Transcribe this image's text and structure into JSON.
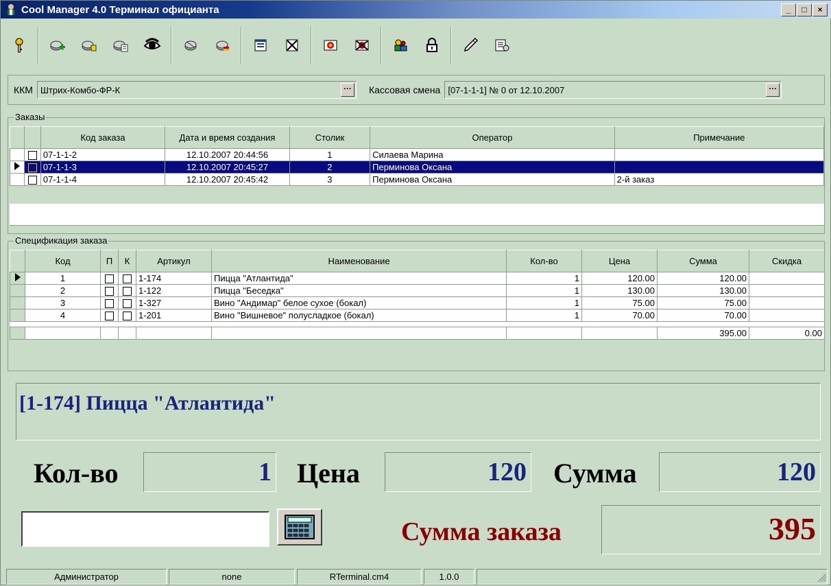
{
  "window": {
    "title": "Cool Manager 4.0  Терминал официанта",
    "minimize": "_",
    "maximize": "□",
    "close": "×"
  },
  "toolbar": {
    "buttons": [
      {
        "icon": "help-key-icon"
      },
      {
        "icon": "new-order-icon"
      },
      {
        "icon": "edit-order-icon"
      },
      {
        "icon": "copy-order-icon"
      },
      {
        "icon": "view-eye-icon"
      },
      {
        "icon": "print-icon"
      },
      {
        "icon": "print-colored-icon"
      },
      {
        "icon": "document-icon"
      },
      {
        "icon": "document-cancel-icon"
      },
      {
        "icon": "payment-icon"
      },
      {
        "icon": "payment-cancel-icon"
      },
      {
        "icon": "users-icon"
      },
      {
        "icon": "lock-icon"
      },
      {
        "icon": "pen-icon"
      },
      {
        "icon": "properties-icon"
      }
    ]
  },
  "kkm": {
    "label": "ККМ",
    "value": "Штрих-Комбо-ФР-К",
    "button": "···",
    "shift_label": "Кассовая смена",
    "shift_value": "[07-1-1-1] № 0 от 12.10.2007",
    "shift_button": "···"
  },
  "orders": {
    "legend": "Заказы",
    "columns": [
      "Код заказа",
      "Дата и время создания",
      "Столик",
      "Оператор",
      "Примечание"
    ],
    "rows": [
      {
        "code": "07-1-1-2",
        "date": "12.10.2007 20:44:56",
        "table": "1",
        "operator": "Силаева Марина",
        "note": ""
      },
      {
        "code": "07-1-1-3",
        "date": "12.10.2007 20:45:27",
        "table": "2",
        "operator": "Перминова Оксана",
        "note": ""
      },
      {
        "code": "07-1-1-4",
        "date": "12.10.2007 20:45:42",
        "table": "3",
        "operator": "Перминова Оксана",
        "note": "2-й заказ"
      }
    ]
  },
  "spec": {
    "legend": "Спецификация заказа",
    "columns": [
      "Код",
      "П",
      "К",
      "Артикул",
      "Наименование",
      "Кол-во",
      "Цена",
      "Сумма",
      "Скидка"
    ],
    "rows": [
      {
        "code": "1",
        "article": "1-174",
        "name": "Пицца \"Атлантида\"",
        "qty": "1",
        "price": "120.00",
        "sum": "120.00",
        "discount": ""
      },
      {
        "code": "2",
        "article": "1-122",
        "name": "Пицца \"Беседка\"",
        "qty": "1",
        "price": "130.00",
        "sum": "130.00",
        "discount": ""
      },
      {
        "code": "3",
        "article": "1-327",
        "name": "Вино \"Андимар\" белое сухое (бокал)",
        "qty": "1",
        "price": "75.00",
        "sum": "75.00",
        "discount": ""
      },
      {
        "code": "4",
        "article": "1-201",
        "name": "Вино \"Вишневое\" полусладкое (бокал)",
        "qty": "1",
        "price": "70.00",
        "sum": "70.00",
        "discount": ""
      }
    ],
    "total_sum": "395.00",
    "total_discount": "0.00"
  },
  "detail": {
    "item_name": "[1-174] Пицца \"Атлантида\"",
    "qty_label": "Кол-во",
    "qty": "1",
    "price_label": "Цена",
    "price": "120",
    "sum_label": "Сумма",
    "sum": "120",
    "order_total_label": "Сумма заказа",
    "order_total": "395",
    "input_value": ""
  },
  "status": {
    "user": "Администратор",
    "db": "none",
    "module": "RTerminal.cm4",
    "version": "1.0.0"
  },
  "colors": {
    "background": "#c8dcc8",
    "selection": "#0a0a80",
    "value_text": "#1a237e",
    "total_text": "#8b0000"
  }
}
